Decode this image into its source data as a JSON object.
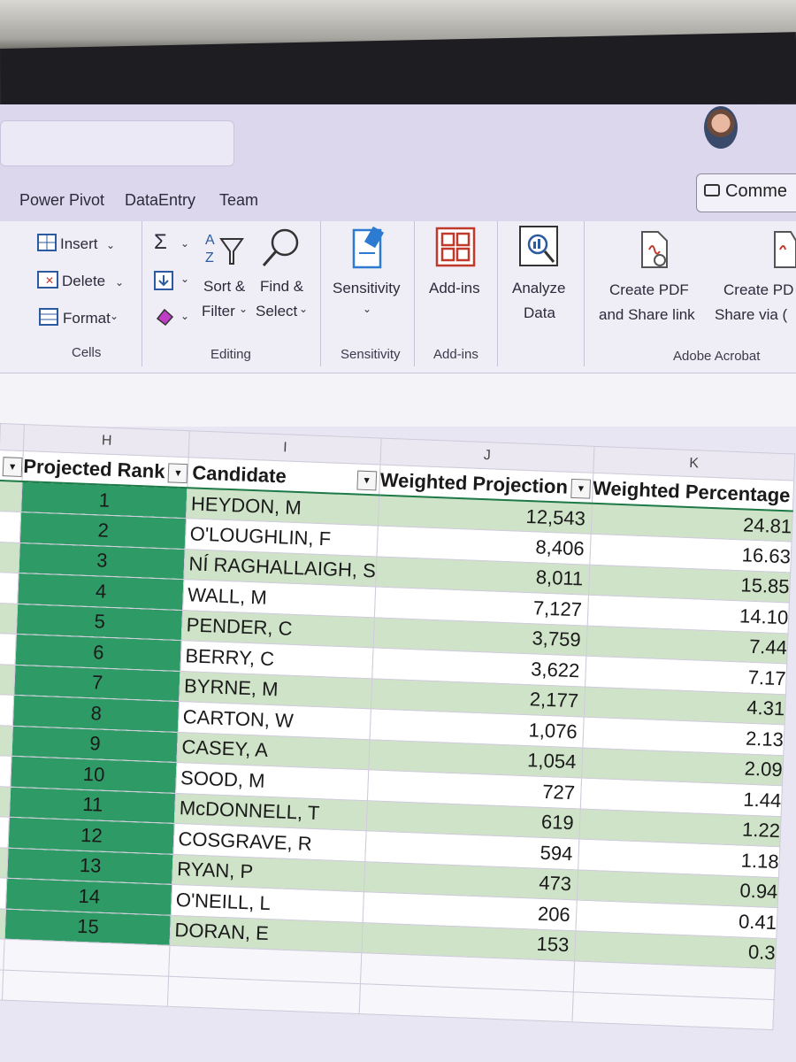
{
  "menu": {
    "items": [
      "Power Pivot",
      "DataEntry",
      "Team"
    ],
    "comments": "Comme"
  },
  "ribbon": {
    "cells": {
      "insert": "Insert",
      "delete": "Delete",
      "format": "Format",
      "group": "Cells"
    },
    "editing": {
      "sort_line1": "Sort &",
      "sort_line2": "Filter",
      "find_line1": "Find &",
      "find_line2": "Select",
      "group": "Editing"
    },
    "sensitivity": {
      "label": "Sensitivity",
      "group": "Sensitivity"
    },
    "addins": {
      "label": "Add-ins",
      "group": "Add-ins"
    },
    "analyze": {
      "line1": "Analyze",
      "line2": "Data"
    },
    "acrobat": {
      "create1_line1": "Create PDF",
      "create1_line2": "and Share link",
      "create2_line1": "Create PD",
      "create2_line2": "Share via (",
      "group": "Adobe Acrobat"
    }
  },
  "sheet": {
    "columns": [
      "H",
      "I",
      "J",
      "K"
    ],
    "headers": {
      "rank": "Projected Rank",
      "candidate": "Candidate",
      "weighted_projection": "Weighted Projection",
      "weighted_percentage": "Weighted Percentage"
    },
    "rows": [
      {
        "rank": "1",
        "candidate": "HEYDON, M",
        "wp": "12,543",
        "pct": "24.81"
      },
      {
        "rank": "2",
        "candidate": "O'LOUGHLIN, F",
        "wp": "8,406",
        "pct": "16.63"
      },
      {
        "rank": "3",
        "candidate": "NÍ RAGHALLAIGH, S",
        "wp": "8,011",
        "pct": "15.85"
      },
      {
        "rank": "4",
        "candidate": "WALL, M",
        "wp": "7,127",
        "pct": "14.10"
      },
      {
        "rank": "5",
        "candidate": "PENDER, C",
        "wp": "3,759",
        "pct": "7.44"
      },
      {
        "rank": "6",
        "candidate": "BERRY, C",
        "wp": "3,622",
        "pct": "7.17"
      },
      {
        "rank": "7",
        "candidate": "BYRNE, M",
        "wp": "2,177",
        "pct": "4.31"
      },
      {
        "rank": "8",
        "candidate": "CARTON, W",
        "wp": "1,076",
        "pct": "2.13"
      },
      {
        "rank": "9",
        "candidate": "CASEY, A",
        "wp": "1,054",
        "pct": "2.09"
      },
      {
        "rank": "10",
        "candidate": "SOOD, M",
        "wp": "727",
        "pct": "1.44"
      },
      {
        "rank": "11",
        "candidate": "McDONNELL, T",
        "wp": "619",
        "pct": "1.22"
      },
      {
        "rank": "12",
        "candidate": "COSGRAVE, R",
        "wp": "594",
        "pct": "1.18"
      },
      {
        "rank": "13",
        "candidate": "RYAN, P",
        "wp": "473",
        "pct": "0.94"
      },
      {
        "rank": "14",
        "candidate": "O'NEILL, L",
        "wp": "206",
        "pct": "0.41"
      },
      {
        "rank": "15",
        "candidate": "DORAN, E",
        "wp": "153",
        "pct": "0.3"
      }
    ]
  },
  "colors": {
    "rank_fill": "#2e9b66",
    "band_fill": "#cfe3c8",
    "ribbon_bg": "#efedf6"
  }
}
